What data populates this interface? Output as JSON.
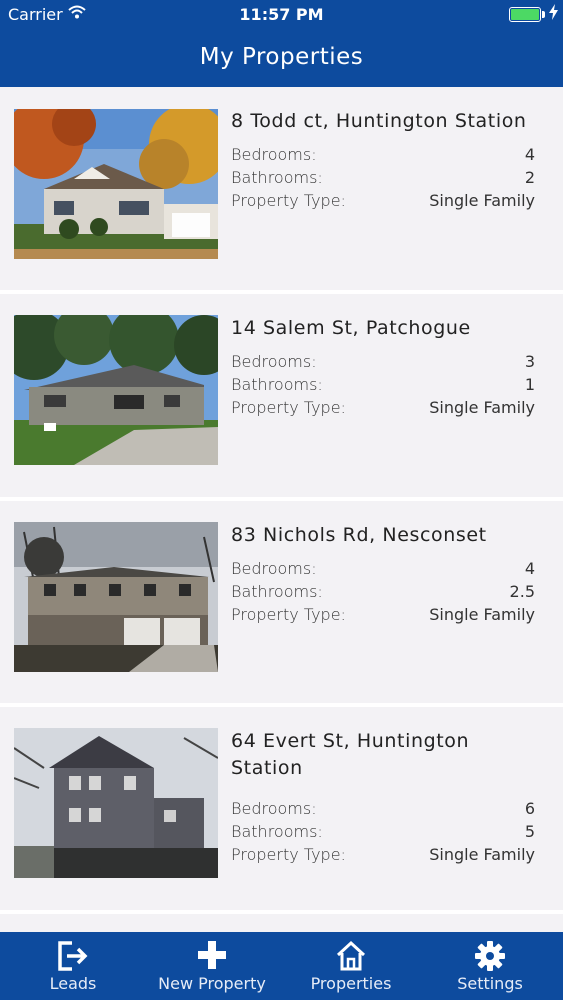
{
  "status_bar": {
    "carrier": "Carrier",
    "time": "11:57 PM"
  },
  "header": {
    "title": "My Properties"
  },
  "labels": {
    "bedrooms": "Bedrooms:",
    "bathrooms": "Bathrooms:",
    "property_type": "Property Type:"
  },
  "properties": [
    {
      "address": "8 Todd ct, Huntington Station",
      "bedrooms": "4",
      "bathrooms": "2",
      "property_type": "Single Family"
    },
    {
      "address": "14 Salem St, Patchogue",
      "bedrooms": "3",
      "bathrooms": "1",
      "property_type": "Single Family"
    },
    {
      "address": "83 Nichols Rd, Nesconset",
      "bedrooms": "4",
      "bathrooms": "2.5",
      "property_type": "Single Family"
    },
    {
      "address": "64 Evert St, Huntington Station",
      "bedrooms": "6",
      "bathrooms": "5",
      "property_type": "Single Family"
    }
  ],
  "tabs": [
    {
      "label": "Leads",
      "icon": "sign-out-icon"
    },
    {
      "label": "New Property",
      "icon": "plus-icon"
    },
    {
      "label": "Properties",
      "icon": "home-icon"
    },
    {
      "label": "Settings",
      "icon": "gear-icon"
    }
  ],
  "colors": {
    "bar": "#0d4b9e",
    "background": "#f3f2f5",
    "battery": "#4cd964"
  }
}
